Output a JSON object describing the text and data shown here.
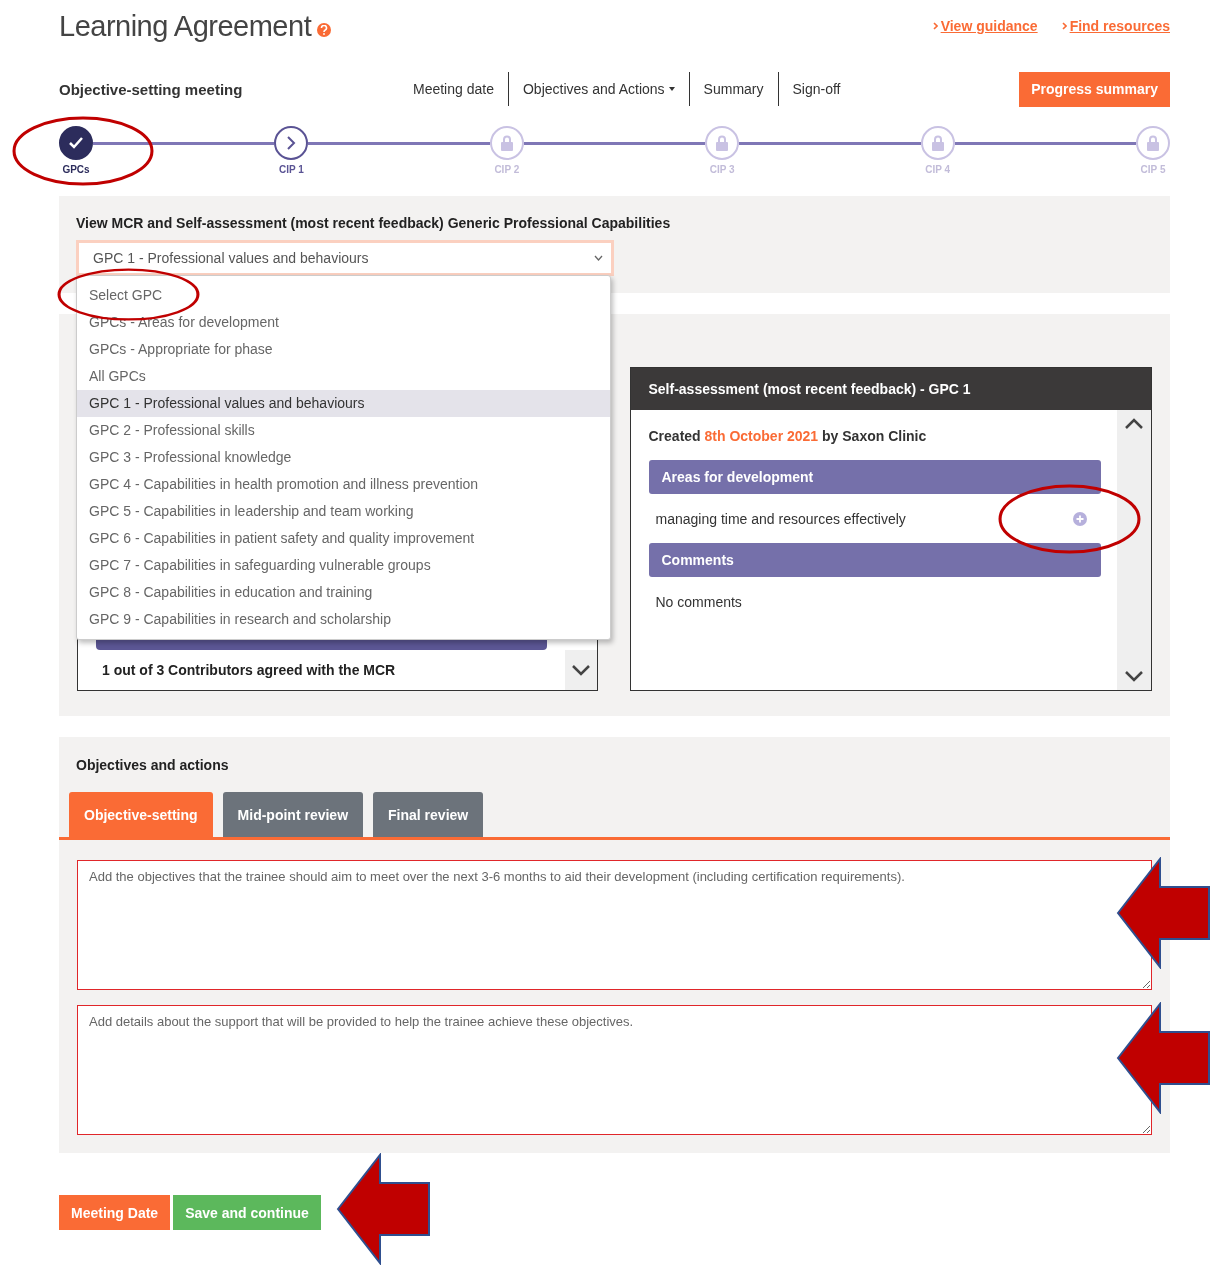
{
  "header": {
    "title": "Learning Agreement",
    "links": [
      "View guidance",
      "Find resources"
    ]
  },
  "subheader": {
    "title": "Objective-setting meeting",
    "nav": [
      {
        "label": "Meeting date",
        "dropdown": false
      },
      {
        "label": "Objectives and Actions",
        "dropdown": true
      },
      {
        "label": "Summary",
        "dropdown": false
      },
      {
        "label": "Sign-off",
        "dropdown": false
      }
    ],
    "button": "Progress summary"
  },
  "steps": [
    {
      "label": "GPCs",
      "kind": "done",
      "circled": true
    },
    {
      "label": "CIP 1",
      "kind": "current"
    },
    {
      "label": "CIP 2",
      "kind": "locked"
    },
    {
      "label": "CIP 3",
      "kind": "locked"
    },
    {
      "label": "CIP 4",
      "kind": "locked"
    },
    {
      "label": "CIP 5",
      "kind": "locked"
    }
  ],
  "gpc_panel": {
    "title": "View MCR and Self-assessment (most recent feedback) Generic Professional Capabilities",
    "select": {
      "value": "GPC 1 - Professional values and behaviours",
      "open": true,
      "options": [
        {
          "label": "Select GPC",
          "selected": false,
          "circled": true
        },
        {
          "label": "GPCs - Areas for development",
          "selected": false
        },
        {
          "label": "GPCs - Appropriate for phase",
          "selected": false
        },
        {
          "label": "All GPCs",
          "selected": false
        },
        {
          "label": "GPC 1 - Professional values and behaviours",
          "selected": true
        },
        {
          "label": "GPC 2 - Professional skills",
          "selected": false
        },
        {
          "label": "GPC 3 - Professional knowledge",
          "selected": false
        },
        {
          "label": "GPC 4 - Capabilities in health promotion and illness prevention",
          "selected": false
        },
        {
          "label": "GPC 5 - Capabilities in leadership and team working",
          "selected": false
        },
        {
          "label": "GPC 6 - Capabilities in patient safety and quality improvement",
          "selected": false
        },
        {
          "label": "GPC 7 - Capabilities in safeguarding vulnerable groups",
          "selected": false
        },
        {
          "label": "GPC 8 - Capabilities in education and training",
          "selected": false
        },
        {
          "label": "GPC 9 - Capabilities in research and scholarship",
          "selected": false
        }
      ]
    }
  },
  "mcr_box": {
    "summary": "1 out of 3 Contributors agreed with the MCR"
  },
  "self_assessment": {
    "title": "Self-assessment (most recent feedback) - GPC 1",
    "created": "Created",
    "date": "8th October 2021",
    "author": "by Saxon Clinic",
    "sections": [
      {
        "heading": "Areas for development",
        "items": [
          {
            "text": "managing time and resources effectively",
            "expandable": true,
            "circled": true
          }
        ]
      },
      {
        "heading": "Comments",
        "items": [
          {
            "text": "No comments",
            "expandable": false
          }
        ]
      }
    ]
  },
  "objectives": {
    "title": "Objectives and actions",
    "tabs": [
      {
        "label": "Objective-setting",
        "selected": true
      },
      {
        "label": "Mid-point review",
        "selected": false
      },
      {
        "label": "Final review",
        "selected": false
      }
    ],
    "fields": [
      {
        "placeholder": "Add the objectives that the trainee should aim to meet over the next 3-6 months to aid their development (including certification requirements).",
        "arrow": true
      },
      {
        "placeholder": "Add details about the support that will be provided to help the trainee achieve these objectives.",
        "arrow": true
      }
    ]
  },
  "buttons": [
    {
      "label": "Meeting Date",
      "kind": "secondary"
    },
    {
      "label": "Save and continue",
      "kind": "primary",
      "arrow": true
    }
  ]
}
